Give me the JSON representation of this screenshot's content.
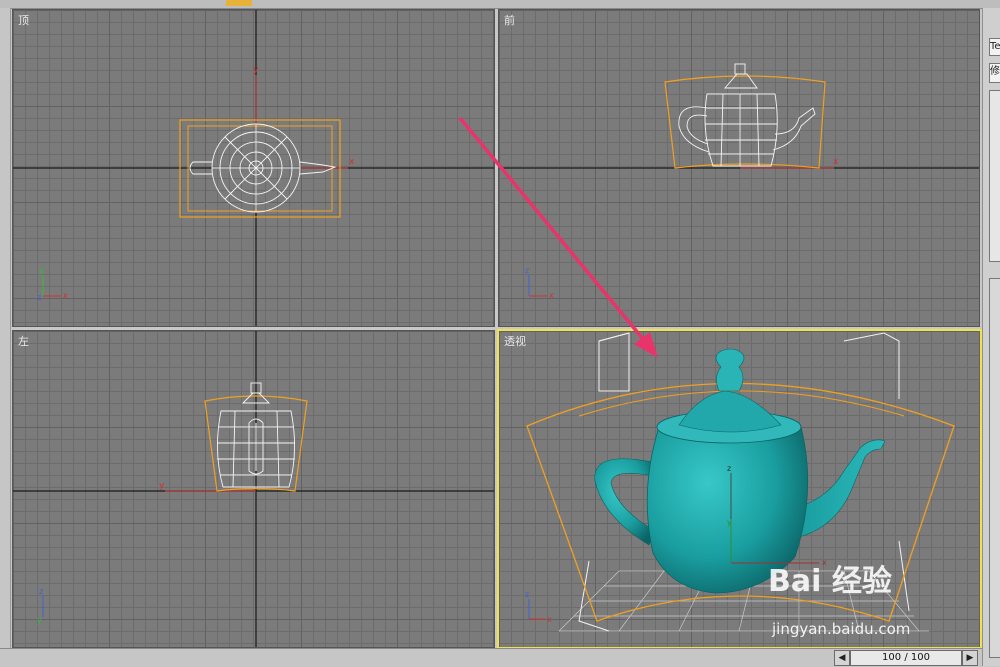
{
  "viewports": {
    "top": {
      "label": "顶"
    },
    "front": {
      "label": "前"
    },
    "left": {
      "label": "左"
    },
    "persp": {
      "label": "透视"
    }
  },
  "axes": {
    "x": "x",
    "y": "y",
    "z": "z"
  },
  "right_panel": {
    "field1": "Te",
    "field2": "修"
  },
  "timeline": {
    "frame": "100 / 100",
    "prev_icon": "triangle-left-icon",
    "next_icon": "triangle-right-icon"
  },
  "watermark": {
    "brand": "Bai 经验",
    "url": "jingyan.baidu.com"
  },
  "colors": {
    "selection": "#f0a020",
    "active_border": "#f0e24a",
    "teapot": "#1fa6a8",
    "annotation_arrow": "#e8346a"
  }
}
